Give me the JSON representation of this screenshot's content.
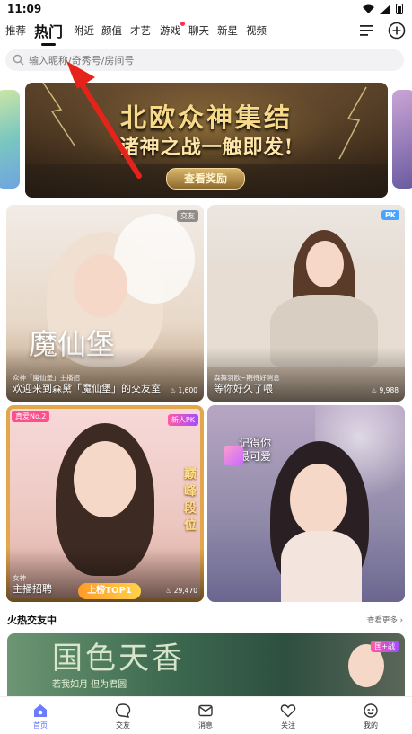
{
  "status_bar": {
    "time": "11:09"
  },
  "nav": {
    "tabs": [
      {
        "label": "推荐"
      },
      {
        "label": "热门"
      },
      {
        "label": "附近"
      },
      {
        "label": "颜值"
      },
      {
        "label": "才艺"
      },
      {
        "label": "游戏"
      },
      {
        "label": "聊天"
      },
      {
        "label": "新星"
      },
      {
        "label": "视频"
      }
    ]
  },
  "search": {
    "placeholder": "输入昵称/奇秀号/房间号"
  },
  "banner": {
    "title": "北欧众神集结",
    "subtitle": "诸神之战一触即发!",
    "button": "查看奖励"
  },
  "cards": [
    {
      "tag": "交友",
      "subtitle": "众神「魔仙堡」主播招",
      "title": "欢迎来到森黛「魔仙堡」的交友室",
      "views": "1,600",
      "overlay_text": "魔仙堡"
    },
    {
      "tag": "PK",
      "subtitle": "森舞羽欧~期待好消息",
      "title": "等你好久了喂",
      "views": "9,988"
    },
    {
      "tag": "真爱No.2",
      "tag2": "新人PK",
      "subtitle": "女神",
      "title": "主播招聘",
      "views": "29,470",
      "overlay_text": "巅峰段位",
      "badge": "上榜TOP1"
    },
    {
      "title": "",
      "overlay_text": "记得你最可爱"
    }
  ],
  "section": {
    "title": "火热交友中",
    "more": "查看更多"
  },
  "banner2": {
    "title": "国色天香",
    "subtitle": "若我如月 但为君圆",
    "tag": "国+战"
  },
  "bottom_nav": [
    {
      "label": "首页"
    },
    {
      "label": "交友"
    },
    {
      "label": "消息"
    },
    {
      "label": "关注"
    },
    {
      "label": "我的"
    }
  ]
}
